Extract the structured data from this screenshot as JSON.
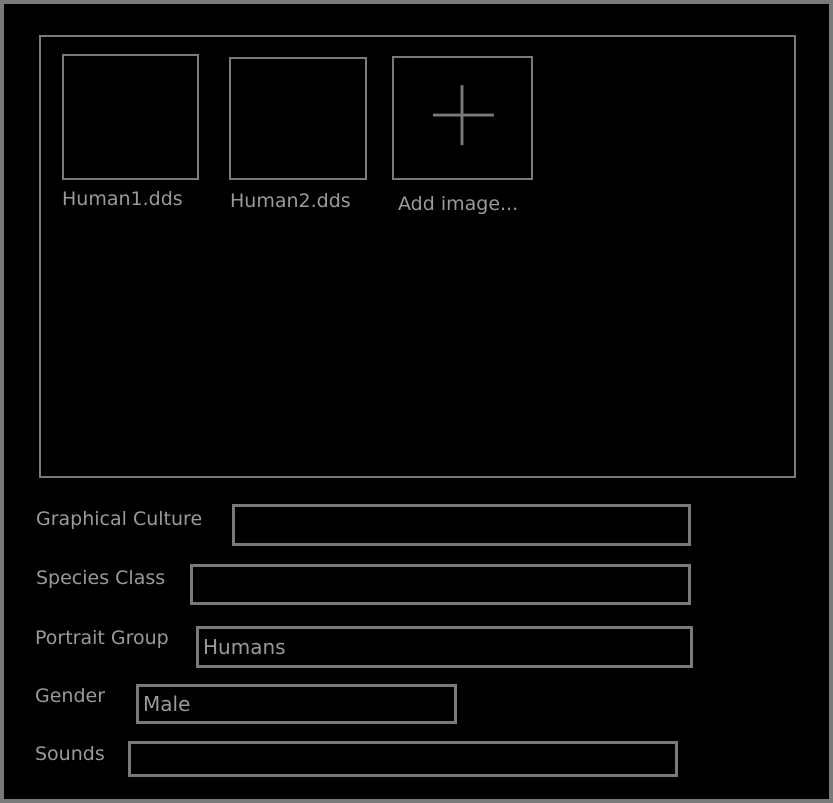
{
  "gallery": {
    "images": [
      {
        "label": "Human1.dds"
      },
      {
        "label": "Human2.dds"
      }
    ],
    "add_label": "Add image...",
    "add_icon": "plus-icon"
  },
  "form": {
    "graphical_culture": {
      "label": "Graphical Culture",
      "value": ""
    },
    "species_class": {
      "label": "Species Class",
      "value": ""
    },
    "portrait_group": {
      "label": "Portrait Group",
      "value": "Humans"
    },
    "gender": {
      "label": "Gender",
      "value": "Male"
    },
    "sounds": {
      "label": "Sounds",
      "value": ""
    }
  },
  "colors": {
    "background": "#000000",
    "border": "#7a7a7a",
    "text": "#9a9a9a"
  }
}
